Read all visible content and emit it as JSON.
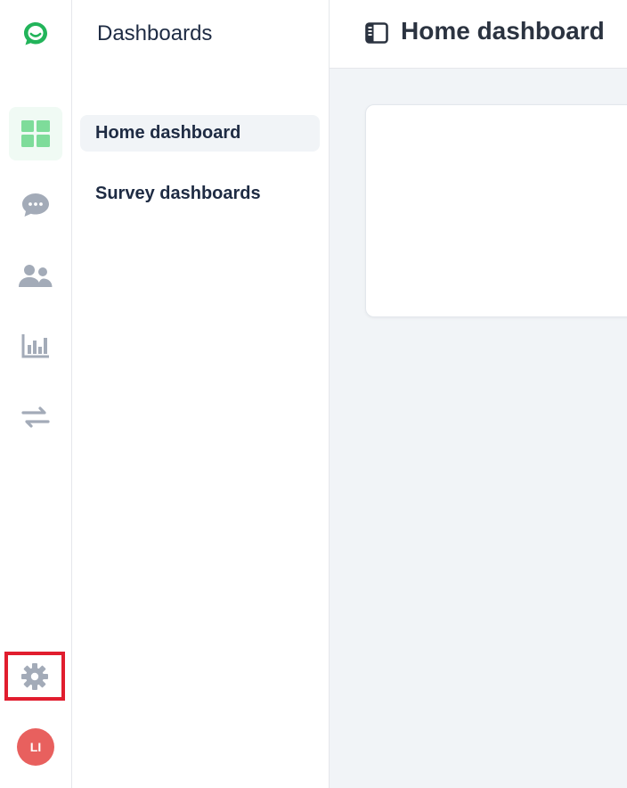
{
  "colors": {
    "brand": "#22b45a",
    "accent_green": "#7edc9a",
    "icon_gray": "#a3abb8",
    "text_dark": "#1e2b43",
    "highlight_red": "#e11d2e",
    "avatar_bg": "#e8605e",
    "content_bg": "#f1f4f7"
  },
  "rail": {
    "logo_icon": "chat-bubble-smile-logo",
    "items": [
      {
        "icon": "dashboard-grid-icon",
        "active": true
      },
      {
        "icon": "chat-bubble-icon",
        "active": false
      },
      {
        "icon": "users-icon",
        "active": false
      },
      {
        "icon": "bar-chart-icon",
        "active": false
      },
      {
        "icon": "transfer-arrows-icon",
        "active": false
      }
    ],
    "settings_icon": "gear-icon",
    "avatar_initials": "LI"
  },
  "sidebar": {
    "title": "Dashboards",
    "items": [
      {
        "label": "Home dashboard",
        "selected": true
      },
      {
        "label": "Survey dashboards",
        "selected": false
      }
    ]
  },
  "header": {
    "toggle_icon": "sidebar-toggle-icon",
    "title": "Home dashboard"
  }
}
